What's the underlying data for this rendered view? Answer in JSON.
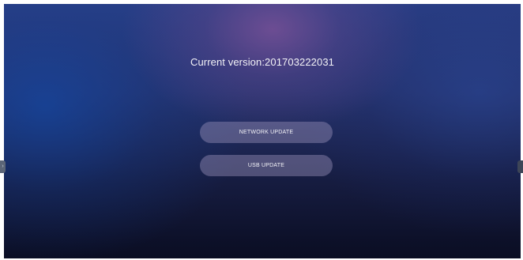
{
  "screen": {
    "version_text": "Current version:201703222031"
  },
  "buttons": {
    "network_update": "NETWORK UPDATE",
    "usb_update": "USB UPDATE"
  },
  "handles": {
    "left_icon": "chevron-right-icon",
    "right_icon": "side-handle"
  },
  "colors": {
    "background_top": "#2a3f86",
    "background_bottom": "#0a0d22",
    "glow": "#785096",
    "button_fill": "#a096be"
  }
}
